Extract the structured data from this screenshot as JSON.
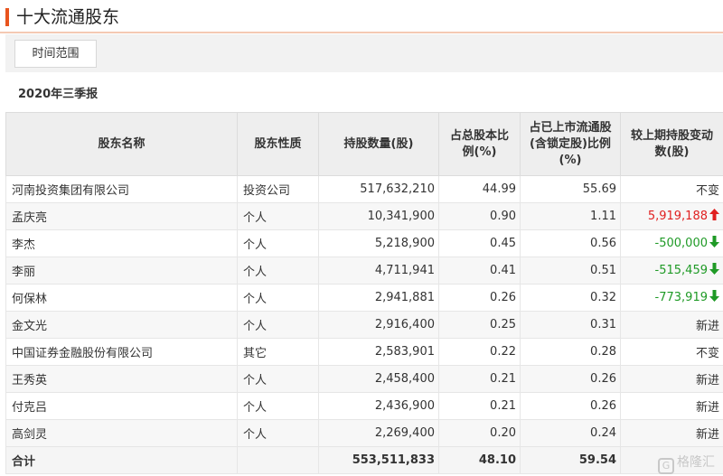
{
  "header": {
    "title": "十大流通股东"
  },
  "filter": {
    "range_label": "时间范围"
  },
  "period": "2020年三季报",
  "table": {
    "columns": [
      "股东名称",
      "股东性质",
      "持股数量(股)",
      "占总股本比例(%)",
      "占已上市流通股(含锁定股)比例(%)",
      "较上期持股变动数(股)"
    ],
    "rows": [
      {
        "name": "河南投资集团有限公司",
        "type": "投资公司",
        "shares": "517,632,210",
        "pct_total": "44.99",
        "pct_float": "55.69",
        "change": "不变",
        "trend": "none"
      },
      {
        "name": "孟庆亮",
        "type": "个人",
        "shares": "10,341,900",
        "pct_total": "0.90",
        "pct_float": "1.11",
        "change": "5,919,188",
        "trend": "up"
      },
      {
        "name": "李杰",
        "type": "个人",
        "shares": "5,218,900",
        "pct_total": "0.45",
        "pct_float": "0.56",
        "change": "-500,000",
        "trend": "down"
      },
      {
        "name": "李丽",
        "type": "个人",
        "shares": "4,711,941",
        "pct_total": "0.41",
        "pct_float": "0.51",
        "change": "-515,459",
        "trend": "down"
      },
      {
        "name": "何保林",
        "type": "个人",
        "shares": "2,941,881",
        "pct_total": "0.26",
        "pct_float": "0.32",
        "change": "-773,919",
        "trend": "down"
      },
      {
        "name": "金文光",
        "type": "个人",
        "shares": "2,916,400",
        "pct_total": "0.25",
        "pct_float": "0.31",
        "change": "新进",
        "trend": "none"
      },
      {
        "name": "中国证券金融股份有限公司",
        "type": "其它",
        "shares": "2,583,901",
        "pct_total": "0.22",
        "pct_float": "0.28",
        "change": "不变",
        "trend": "none"
      },
      {
        "name": "王秀英",
        "type": "个人",
        "shares": "2,458,400",
        "pct_total": "0.21",
        "pct_float": "0.26",
        "change": "新进",
        "trend": "none"
      },
      {
        "name": "付克吕",
        "type": "个人",
        "shares": "2,436,900",
        "pct_total": "0.21",
        "pct_float": "0.26",
        "change": "新进",
        "trend": "none"
      },
      {
        "name": "高剑灵",
        "type": "个人",
        "shares": "2,269,400",
        "pct_total": "0.20",
        "pct_float": "0.24",
        "change": "新进",
        "trend": "none"
      }
    ],
    "total": {
      "label": "合计",
      "shares": "553,511,833",
      "pct_total": "48.10",
      "pct_float": "59.54"
    }
  },
  "watermark": {
    "logo": "G",
    "text": "格隆汇"
  },
  "colors": {
    "accent": "#e8541e",
    "up": "#e02020",
    "down": "#1f9a26"
  },
  "icons": {
    "up": "arrow-up-icon",
    "down": "arrow-down-icon"
  }
}
